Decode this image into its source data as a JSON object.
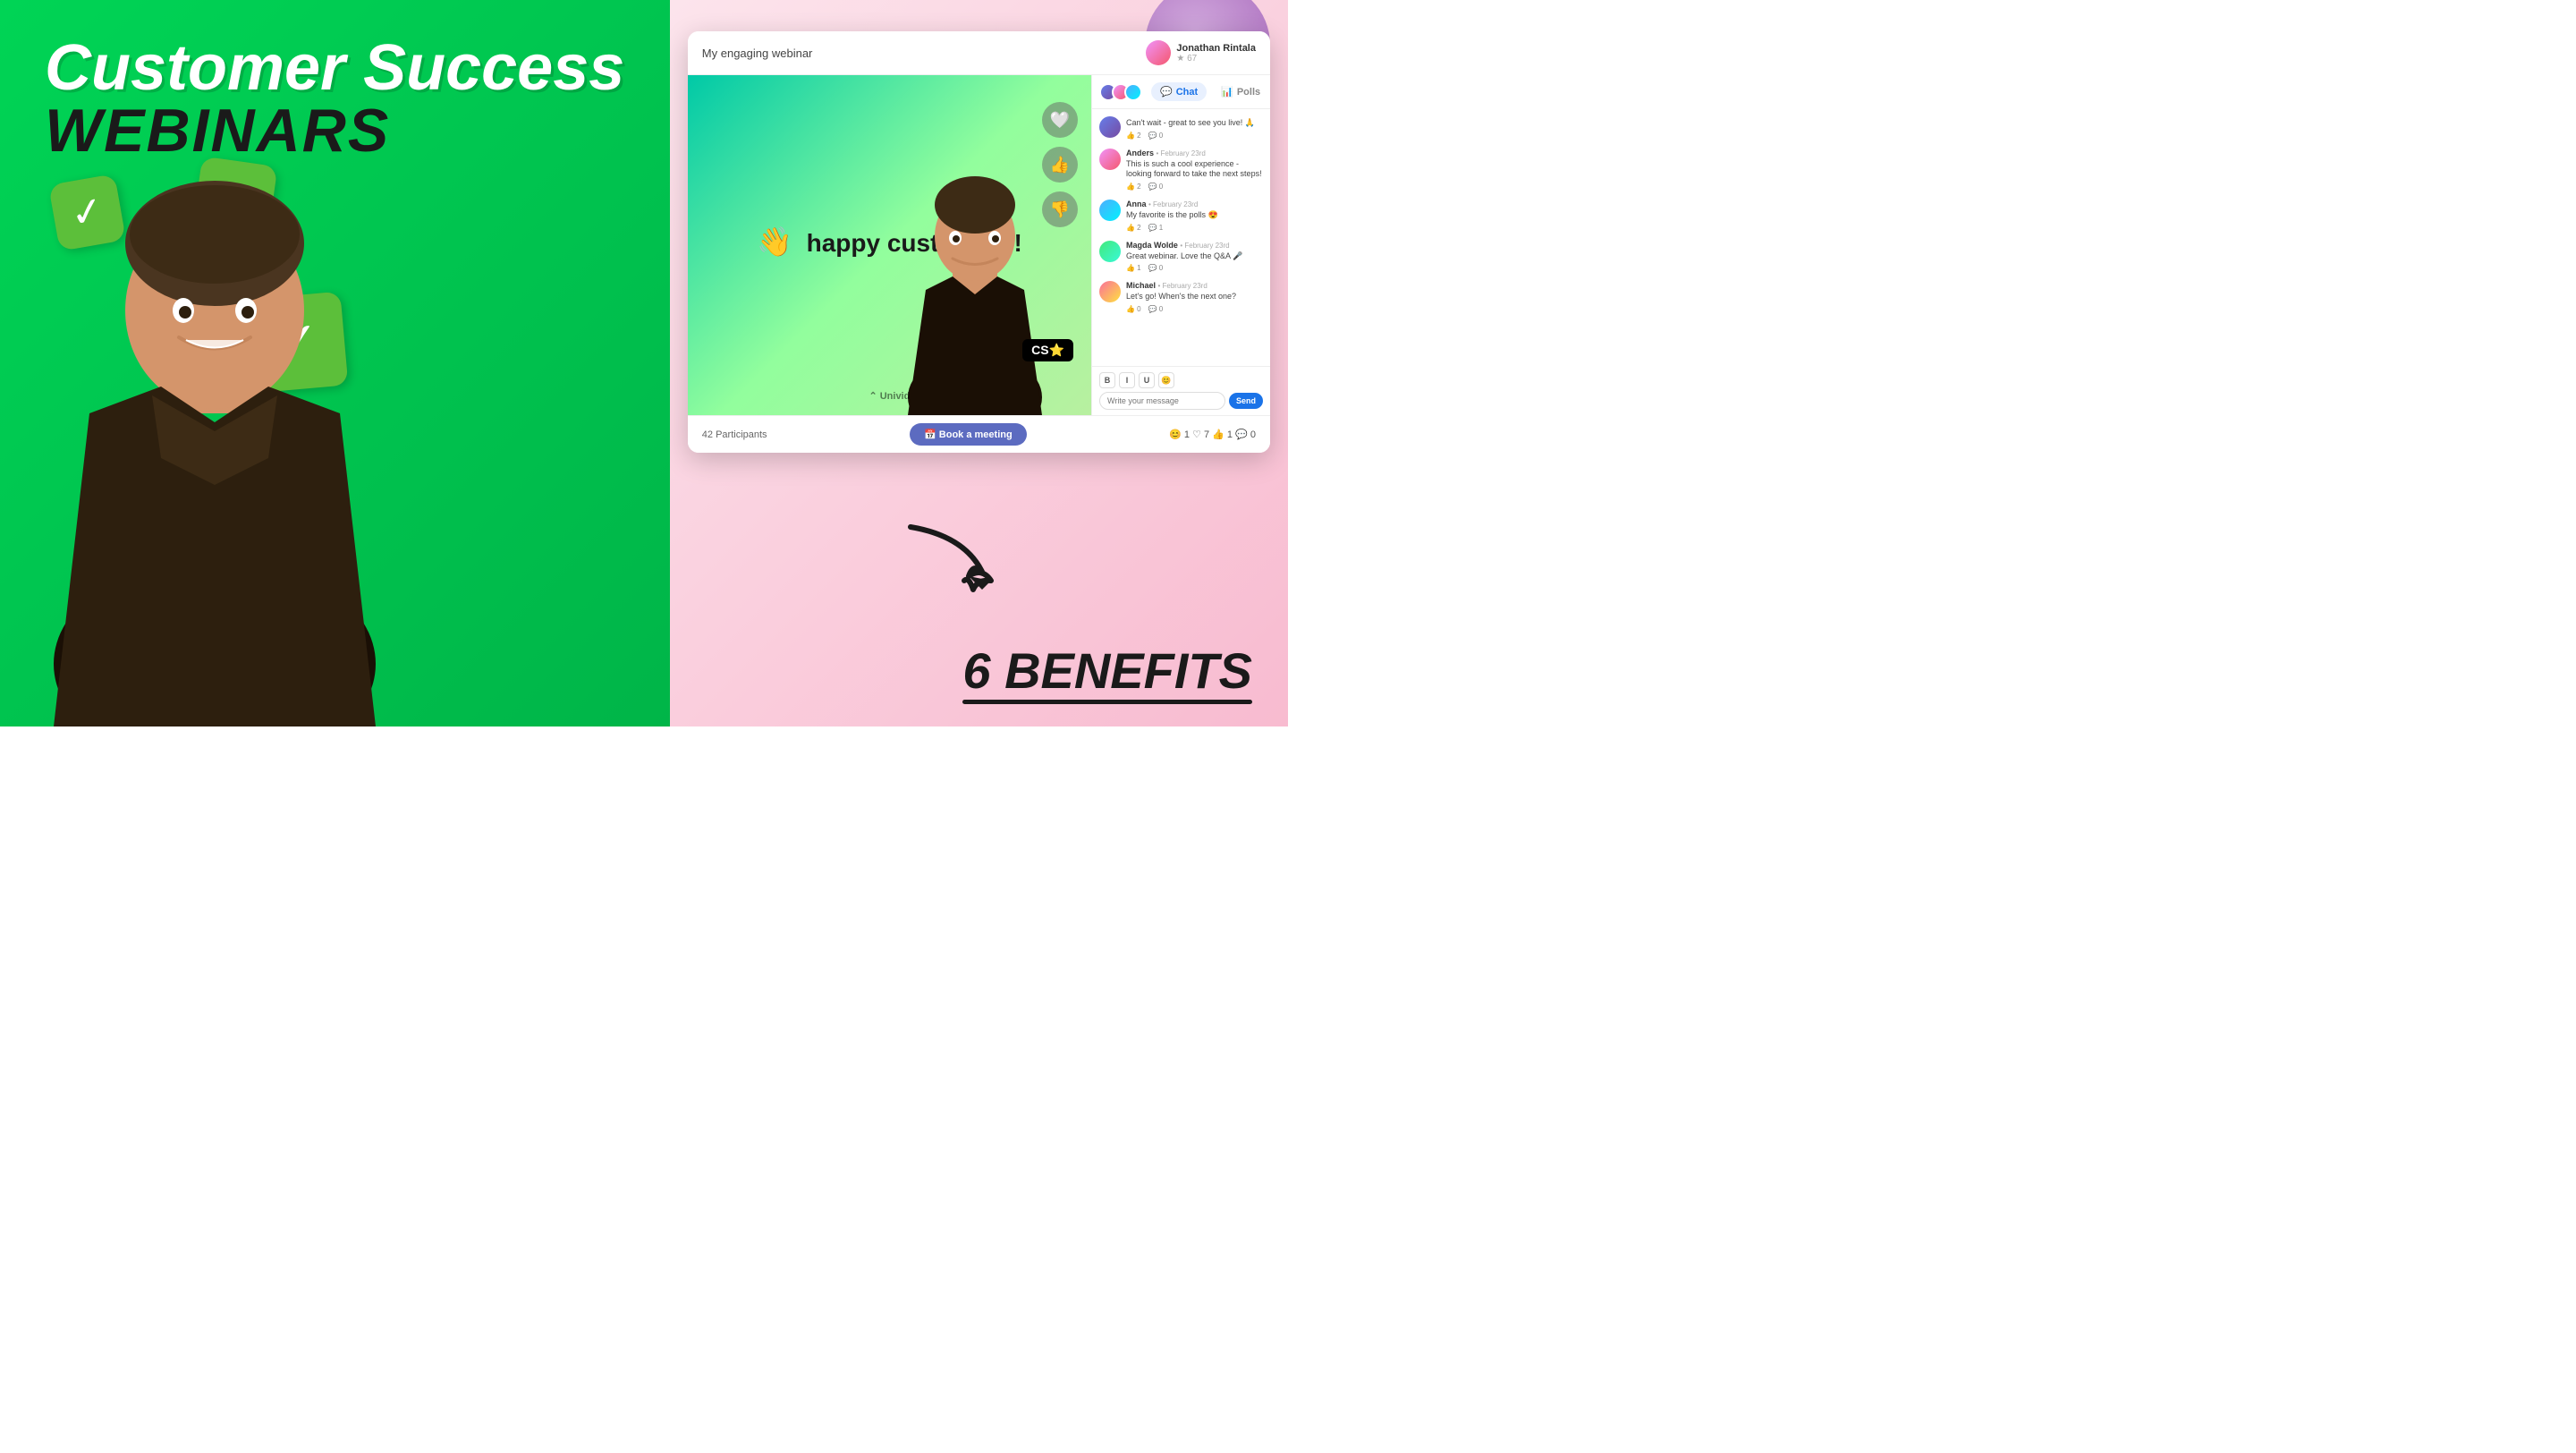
{
  "left": {
    "title_line1": "Customer Success",
    "title_line2": "WEBINARS"
  },
  "right": {
    "webinar_title": "My engaging webinar",
    "host_name": "Jonathan Rintala",
    "host_stars": "★ 67",
    "participants": "42 Participants",
    "book_btn": "📅 Book a meeting",
    "reactions": "😊 1  ♡ 7  👍 1  💬 0",
    "univid_logo": "⌃ Univid",
    "speaker_badge": "CS⭐",
    "chat_tab": "Chat",
    "polls_tab": "Polls",
    "video_text": "happy customers!",
    "benefits_text": "6 BENEFITS"
  },
  "chat": {
    "messages": [
      {
        "user": "",
        "date": "",
        "text": "Can't wait - great to see you live! 🙏",
        "likes": "2",
        "comments": "0",
        "avatar_class": "av1"
      },
      {
        "user": "Anders",
        "date": "February 23rd",
        "text": "This is such a cool experience - looking forward to take the next steps!",
        "likes": "2",
        "comments": "0",
        "avatar_class": "av2"
      },
      {
        "user": "Anna",
        "date": "February 23rd",
        "text": "My favorite is the polls 😍",
        "likes": "2",
        "comments": "1",
        "avatar_class": "av3"
      },
      {
        "user": "Magda Wolde",
        "date": "February 23rd",
        "text": "Great webinar. Love the Q&A 🎤",
        "likes": "1",
        "comments": "0",
        "avatar_class": "av4"
      },
      {
        "user": "Michael",
        "date": "February 23rd",
        "text": "Let's go! When's the next one?",
        "likes": "0",
        "comments": "0",
        "avatar_class": "av5"
      }
    ],
    "input_placeholder": "Write your message",
    "send_label": "Send",
    "toolbar": [
      "B",
      "I",
      "U",
      "😊"
    ]
  }
}
